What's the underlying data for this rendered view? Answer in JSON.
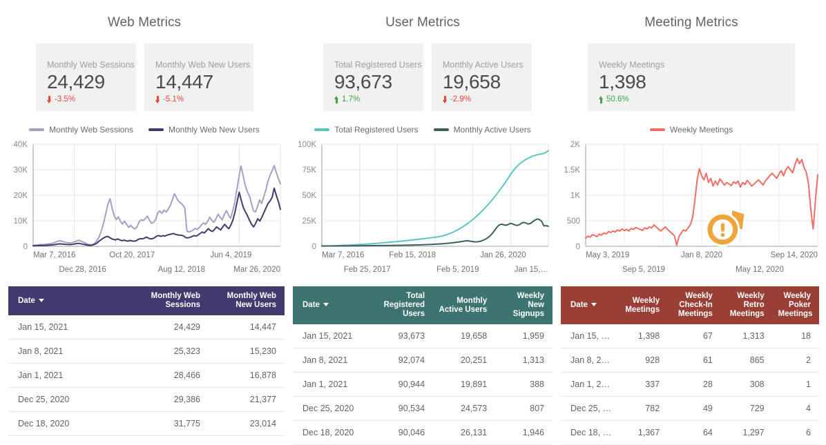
{
  "panels": [
    {
      "title": "Web Metrics",
      "kpis": [
        {
          "label": "Monthly Web Sessions",
          "value": "24,429",
          "delta": "-3.5%",
          "direction": "down"
        },
        {
          "label": "Monthly Web New Users",
          "value": "14,447",
          "delta": "-5.1%",
          "direction": "down"
        }
      ],
      "legend": [
        {
          "label": "Monthly Web Sessions",
          "color": "#a89ec4"
        },
        {
          "label": "Monthly Web New Users",
          "color": "#413a6e"
        }
      ],
      "table": {
        "header_color": "#413a6e",
        "columns": [
          "Date",
          "Monthly Web Sessions",
          "Monthly Web New Users"
        ],
        "sort_column": "Date",
        "rows": [
          [
            "Jan 15, 2021",
            "24,429",
            "14,447"
          ],
          [
            "Jan 8, 2021",
            "25,323",
            "15,230"
          ],
          [
            "Jan 1, 2021",
            "28,466",
            "16,878"
          ],
          [
            "Dec 25, 2020",
            "29,386",
            "21,377"
          ],
          [
            "Dec 18, 2020",
            "31,775",
            "23,014"
          ]
        ]
      }
    },
    {
      "title": "User Metrics",
      "kpis": [
        {
          "label": "Total Registered Users",
          "value": "93,673",
          "delta": "1.7%",
          "direction": "up"
        },
        {
          "label": "Monthly Active Users",
          "value": "19,658",
          "delta": "-2.9%",
          "direction": "down"
        }
      ],
      "legend": [
        {
          "label": "Total Registered Users",
          "color": "#5bc6c0"
        },
        {
          "label": "Monthly Active Users",
          "color": "#3a5f63"
        }
      ],
      "table": {
        "header_color": "#3d7470",
        "columns": [
          "Date",
          "Total Registered Users",
          "Monthly Active Users",
          "Weekly New Signups"
        ],
        "sort_column": "Date",
        "rows": [
          [
            "Jan 15, 2021",
            "93,673",
            "19,658",
            "1,959"
          ],
          [
            "Jan 8, 2021",
            "92,074",
            "20,251",
            "1,313"
          ],
          [
            "Jan 1, 2021",
            "90,944",
            "19,891",
            "388"
          ],
          [
            "Dec 25, 2020",
            "90,534",
            "24,573",
            "807"
          ],
          [
            "Dec 18, 2020",
            "90,046",
            "26,131",
            "1,946"
          ]
        ]
      }
    },
    {
      "title": "Meeting Metrics",
      "kpis": [
        {
          "label": "Weekly Meetings",
          "value": "1,398",
          "delta": "50.6%",
          "direction": "up"
        }
      ],
      "legend": [
        {
          "label": "Weekly Meetings",
          "color": "#ef6d62"
        }
      ],
      "alert": {
        "icon": "alert-exclamation-icon",
        "color": "#efa43c"
      },
      "table": {
        "header_color": "#9a3f36",
        "columns": [
          "Date",
          "Weekly Meetings",
          "Weekly Check-In Meetings",
          "Weekly Retro Meetings",
          "Weekly Poker Meetings"
        ],
        "sort_column": "Date",
        "rows": [
          [
            "Jan 15, 2…",
            "1,398",
            "67",
            "1,313",
            "18"
          ],
          [
            "Jan 8, 20…",
            "928",
            "61",
            "865",
            "2"
          ],
          [
            "Jan 1, 20…",
            "337",
            "28",
            "308",
            "1"
          ],
          [
            "Dec 25, 2…",
            "782",
            "49",
            "729",
            "4"
          ],
          [
            "Dec 18, 2…",
            "1,367",
            "64",
            "1,297",
            "6"
          ]
        ]
      }
    }
  ],
  "chart_data": [
    {
      "type": "line",
      "title": "Web Metrics",
      "xlabel": "",
      "ylabel": "",
      "ylim": [
        0,
        40000
      ],
      "yticks": [
        "0",
        "10K",
        "20K",
        "30K",
        "40K"
      ],
      "xticks_top": [
        "Mar 7, 2016",
        "Oct 20, 2017",
        "Jun 4, 2019"
      ],
      "xticks_bottom": [
        "Dec 28, 2016",
        "Aug 12, 2018",
        "Mar 26, 2020"
      ],
      "grid": true,
      "legend_position": "top",
      "series": [
        {
          "name": "Monthly Web Sessions",
          "color": "#a89ec4",
          "values": [
            400,
            450,
            500,
            600,
            700,
            650,
            800,
            900,
            1000,
            1100,
            1400,
            1700,
            2000,
            2200,
            1900,
            1700,
            1500,
            1400,
            1300,
            1500,
            1800,
            2100,
            2400,
            2000,
            1700,
            1300,
            900,
            700,
            600,
            900,
            1500,
            2600,
            4200,
            6500,
            9500,
            13000,
            16500,
            18600,
            15000,
            12000,
            10500,
            11500,
            9800,
            8700,
            9900,
            8600,
            7400,
            8200,
            7300,
            6800,
            7600,
            9600,
            10400,
            10100,
            10900,
            11800,
            10200,
            9000,
            9400,
            10600,
            13100,
            13900,
            12900,
            14200,
            13400,
            14600,
            16000,
            18200,
            20600,
            19000,
            17600,
            17000,
            16200,
            15000,
            6000,
            5600,
            5900,
            6400,
            7000,
            6600,
            7400,
            8400,
            9200,
            8600,
            9800,
            11400,
            10200,
            9400,
            10800,
            12600,
            11400,
            10400,
            12400,
            14000,
            12200,
            11000,
            13600,
            17000,
            22000,
            27000,
            31500,
            28000,
            24000,
            21500,
            20000,
            17000,
            14000,
            13400,
            15600,
            18200,
            16800,
            19400,
            22000,
            25400,
            27800,
            29600,
            31600,
            29000,
            26600,
            24429
          ]
        },
        {
          "name": "Monthly Web New Users",
          "color": "#413a6e",
          "values": [
            200,
            230,
            260,
            300,
            340,
            320,
            380,
            420,
            470,
            520,
            620,
            740,
            880,
            980,
            880,
            800,
            740,
            700,
            680,
            760,
            900,
            1050,
            1200,
            1000,
            860,
            680,
            500,
            400,
            360,
            520,
            800,
            1300,
            2000,
            2600,
            3200,
            3600,
            3900,
            3500,
            3000,
            2700,
            2500,
            2900,
            2500,
            2200,
            2400,
            2200,
            2000,
            2300,
            2100,
            2000,
            2200,
            2700,
            3000,
            2900,
            3200,
            3600,
            3200,
            2900,
            3000,
            3400,
            4000,
            4200,
            3900,
            4200,
            4000,
            4400,
            4600,
            4800,
            5000,
            4700,
            4500,
            4400,
            4300,
            4100,
            3400,
            3300,
            3500,
            3800,
            4200,
            4000,
            4400,
            5000,
            5600,
            5200,
            6000,
            6900,
            6200,
            5800,
            6600,
            7600,
            7000,
            6400,
            7600,
            8600,
            7600,
            6900,
            8400,
            10400,
            13500,
            17500,
            21200,
            18000,
            15200,
            13500,
            12000,
            10200,
            8600,
            7600,
            9000,
            10800,
            9900,
            11400,
            13200,
            15000,
            16800,
            17800,
            19200,
            22800,
            20000,
            17600,
            14447
          ]
        }
      ]
    },
    {
      "type": "line",
      "title": "User Metrics",
      "xlabel": "",
      "ylabel": "",
      "ylim": [
        0,
        100000
      ],
      "yticks": [
        "0",
        "25K",
        "50K",
        "75K",
        "100K"
      ],
      "xticks_top": [
        "Mar 7, 2016",
        "Feb 15, 2018",
        "Jan 26, 2020"
      ],
      "xticks_bottom": [
        "Feb 25, 2017",
        "Feb 5, 2019",
        "Jan 15,…"
      ],
      "grid": true,
      "legend_position": "top",
      "series": [
        {
          "name": "Total Registered Users",
          "color": "#5bc6c0",
          "values": [
            200,
            260,
            320,
            390,
            460,
            540,
            620,
            710,
            800,
            900,
            1000,
            1110,
            1220,
            1340,
            1460,
            1590,
            1720,
            1860,
            2000,
            2150,
            2300,
            2460,
            2620,
            2790,
            2960,
            3140,
            3320,
            3510,
            3700,
            3900,
            4100,
            4310,
            4520,
            4740,
            4960,
            5190,
            5420,
            5660,
            5900,
            6150,
            6400,
            6660,
            6920,
            7190,
            7460,
            7740,
            8020,
            8310,
            8600,
            8900,
            9200,
            9600,
            10100,
            10700,
            11400,
            12200,
            13100,
            14100,
            15200,
            16400,
            17700,
            19100,
            20600,
            22200,
            23900,
            25700,
            27600,
            29600,
            31700,
            33900,
            36200,
            38600,
            41100,
            43700,
            46400,
            49200,
            52100,
            55100,
            58200,
            61400,
            64700,
            68100,
            71600,
            74600,
            77200,
            79500,
            81500,
            83200,
            84700,
            86000,
            87100,
            88100,
            88900,
            89600,
            90046,
            90534,
            90944,
            92074,
            93673
          ]
        },
        {
          "name": "Monthly Active Users",
          "color": "#3a5f63",
          "values": [
            300,
            310,
            320,
            330,
            340,
            350,
            360,
            370,
            380,
            400,
            420,
            440,
            460,
            480,
            500,
            520,
            540,
            560,
            580,
            600,
            620,
            640,
            660,
            680,
            700,
            720,
            740,
            760,
            780,
            800,
            830,
            860,
            890,
            920,
            950,
            980,
            1020,
            1060,
            1100,
            1150,
            1200,
            1260,
            1320,
            1390,
            1460,
            1540,
            1620,
            1710,
            1800,
            1900,
            2000,
            2120,
            2250,
            2400,
            2560,
            2740,
            2940,
            3160,
            3400,
            3660,
            3940,
            4240,
            4560,
            4900,
            5200,
            5400,
            5100,
            4700,
            4400,
            4300,
            4600,
            5200,
            6000,
            7000,
            8400,
            10200,
            12600,
            15500,
            18500,
            20800,
            21600,
            21200,
            20600,
            21200,
            22400,
            22000,
            21000,
            20400,
            21000,
            22600,
            23400,
            22800,
            21800,
            22400,
            24000,
            25600,
            26800,
            26131,
            24573,
            19891,
            20251,
            19658
          ]
        }
      ]
    },
    {
      "type": "line",
      "title": "Meeting Metrics",
      "xlabel": "",
      "ylabel": "",
      "ylim": [
        0,
        2000
      ],
      "yticks": [
        "0",
        "500",
        "1K",
        "1.5K",
        "2K"
      ],
      "xticks_top": [
        "May 3, 2019",
        "Jan 8, 2020",
        "Sep 14, 2020"
      ],
      "xticks_bottom": [
        "Sep 5, 2019",
        "May 12, 2020"
      ],
      "grid": true,
      "legend_position": "top",
      "series": [
        {
          "name": "Weekly Meetings",
          "color": "#ef6d62",
          "values": [
            160,
            200,
            180,
            230,
            210,
            190,
            240,
            220,
            260,
            240,
            290,
            270,
            300,
            280,
            320,
            300,
            340,
            310,
            330,
            300,
            350,
            330,
            370,
            350,
            330,
            310,
            360,
            340,
            380,
            360,
            420,
            380,
            340,
            300,
            340,
            380,
            330,
            290,
            250,
            210,
            20,
            190,
            260,
            320,
            300,
            360,
            420,
            560,
            900,
            1300,
            1520,
            1380,
            1300,
            1430,
            1250,
            1330,
            1180,
            1280,
            1200,
            1320,
            1260,
            1200,
            1250,
            1220,
            1190,
            1260,
            1230,
            1280,
            1160,
            1250,
            1210,
            1290,
            1240,
            1180,
            1220,
            1260,
            1300,
            1250,
            1200,
            1280,
            1330,
            1390,
            1430,
            1380,
            1330,
            1420,
            1480,
            1380,
            1500,
            1560,
            1500,
            1440,
            1600,
            1720,
            1620,
            1700,
            1540,
            1450,
            1200,
            700,
            340,
            900,
            1398
          ]
        }
      ]
    }
  ]
}
